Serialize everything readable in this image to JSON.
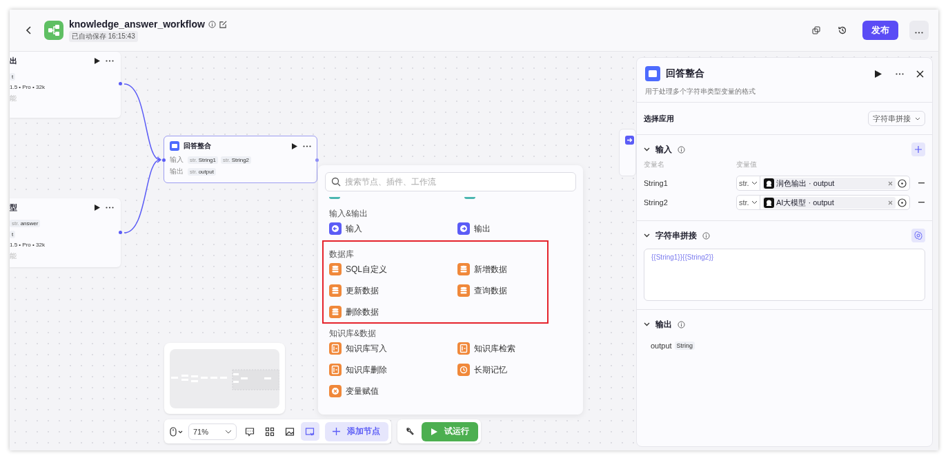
{
  "header": {
    "title": "knowledge_answer_workflow",
    "autosave": "已自动保存 16:15:43",
    "publish": "发布"
  },
  "canvas": {
    "nodes": [
      {
        "lines": [
          {
            "kind": "title",
            "text": "出"
          },
          {
            "kind": "chip",
            "text": "t"
          },
          {
            "kind": "text",
            "text": "1.5 • Pro • 32k"
          },
          {
            "kind": "muted",
            "text": "能"
          }
        ]
      },
      {
        "lines": [
          {
            "kind": "title",
            "text": "型"
          },
          {
            "kind": "chip",
            "text": "answer",
            "type": "str."
          },
          {
            "kind": "chip",
            "text": "t"
          },
          {
            "kind": "text",
            "text": "1.5 • Pro • 32k"
          },
          {
            "kind": "muted",
            "text": "能"
          }
        ]
      }
    ],
    "main_node": {
      "title": "回答整合",
      "selected": true,
      "rows": [
        {
          "label": "输入",
          "chips": [
            {
              "type": "str.",
              "text": "String1"
            },
            {
              "type": "str.",
              "text": "String2"
            }
          ]
        },
        {
          "label": "输出",
          "chips": [
            {
              "type": "str.",
              "text": "output"
            }
          ]
        }
      ]
    }
  },
  "add_node_menu": {
    "placeholder": "搜索节点、插件、工作流",
    "sections": [
      {
        "title": "输入&输出",
        "highlighted": false,
        "items": [
          {
            "label": "输入",
            "kind": "input"
          },
          {
            "label": "输出",
            "kind": "output"
          }
        ]
      },
      {
        "title": "数据库",
        "highlighted": true,
        "items": [
          {
            "label": "SQL自定义",
            "kind": "database"
          },
          {
            "label": "新增数据",
            "kind": "database"
          },
          {
            "label": "更新数据",
            "kind": "database"
          },
          {
            "label": "查询数据",
            "kind": "database"
          },
          {
            "label": "删除数据",
            "kind": "database"
          }
        ]
      },
      {
        "title": "知识库&数据",
        "highlighted": false,
        "items": [
          {
            "label": "知识库写入",
            "kind": "document"
          },
          {
            "label": "知识库检索",
            "kind": "document"
          },
          {
            "label": "知识库删除",
            "kind": "document"
          },
          {
            "label": "长期记忆",
            "kind": "memory"
          },
          {
            "label": "变量赋值",
            "kind": "variable"
          }
        ]
      }
    ]
  },
  "toolbar": {
    "zoom": "71%",
    "tools": [
      {
        "selected": false
      },
      {
        "selected": false
      },
      {
        "selected": false
      },
      {
        "selected": true
      }
    ],
    "add_node": "添加节点",
    "test_run": "试运行"
  },
  "panel": {
    "title": "回答整合",
    "description": "用于处理多个字符串类型变量的格式",
    "app_label": "选择应用",
    "app_value": "字符串拼接",
    "input": {
      "title": "输入",
      "expanded": true,
      "columns": [
        "变量名",
        "变量值"
      ],
      "rows": [
        {
          "name": "String1",
          "type": "str.",
          "source": "润色输出 · output"
        },
        {
          "name": "String2",
          "type": "str.",
          "source": "AI大模型 · output"
        }
      ]
    },
    "concat": {
      "title": "字符串拼接",
      "expanded": true,
      "template": "{{String1}}{{String2}}"
    },
    "output": {
      "title": "输出",
      "expanded": true,
      "fields": [
        {
          "name": "output",
          "type": "String"
        }
      ]
    }
  }
}
